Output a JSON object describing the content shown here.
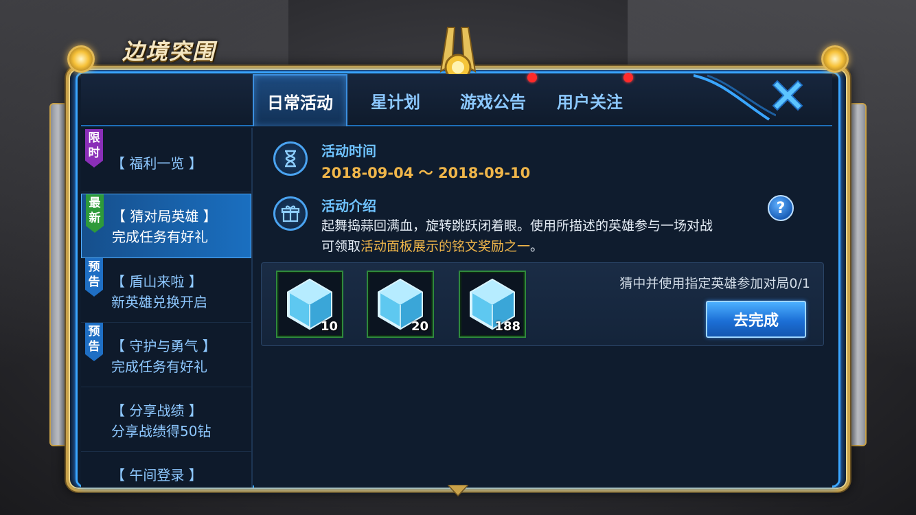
{
  "game_title": "边境突围",
  "tabs": [
    {
      "label": "日常活动",
      "active": true,
      "dot": false
    },
    {
      "label": "星计划",
      "active": false,
      "dot": false
    },
    {
      "label": "游戏公告",
      "active": false,
      "dot": true
    },
    {
      "label": "用户关注",
      "active": false,
      "dot": true
    }
  ],
  "sidebar": {
    "items": [
      {
        "badge": "限时",
        "badge_color": "#8a2fb8",
        "title": "【 福利一览 】",
        "subtitle": "",
        "active": false
      },
      {
        "badge": "最新",
        "badge_color": "#2e9a3a",
        "title": "【 猜对局英雄 】",
        "subtitle": "完成任务有好礼",
        "active": true
      },
      {
        "badge": "预告",
        "badge_color": "#1f6fc4",
        "title": "【 盾山来啦 】",
        "subtitle": "新英雄兑换开启",
        "active": false
      },
      {
        "badge": "预告",
        "badge_color": "#1f6fc4",
        "title": "【 守护与勇气 】",
        "subtitle": "完成任务有好礼",
        "active": false
      },
      {
        "badge": "",
        "badge_color": "",
        "title": "【 分享战绩 】",
        "subtitle": "分享战绩得50钻",
        "active": false
      },
      {
        "badge": "",
        "badge_color": "",
        "title": "【 午间登录 】",
        "subtitle": "",
        "active": false
      }
    ]
  },
  "activity": {
    "time_label": "活动时间",
    "time_range": "2018-09-04 ～ 2018-09-10",
    "intro_label": "活动介绍",
    "intro_line1": "起舞捣蒜回满血，旋转跳跃闭着眼。使用所描述的英雄参与一场对战",
    "intro_line2_prefix": "可领取",
    "intro_line2_highlight": "活动面板展示的铭文奖励之一",
    "intro_line2_suffix": "。",
    "help_label": "?"
  },
  "rewards": {
    "items": [
      {
        "icon": "crystal-icon",
        "count": "10"
      },
      {
        "icon": "crystal-icon",
        "count": "20"
      },
      {
        "icon": "crystal-icon",
        "count": "188"
      }
    ],
    "task_text": "猜中并使用指定英雄参加对局0/1",
    "button_label": "去完成"
  },
  "colors": {
    "gold": "#c9a24a",
    "accent_blue": "#3aa6ff",
    "highlight_orange": "#f0b64a",
    "notification_red": "#ff2a2a"
  }
}
